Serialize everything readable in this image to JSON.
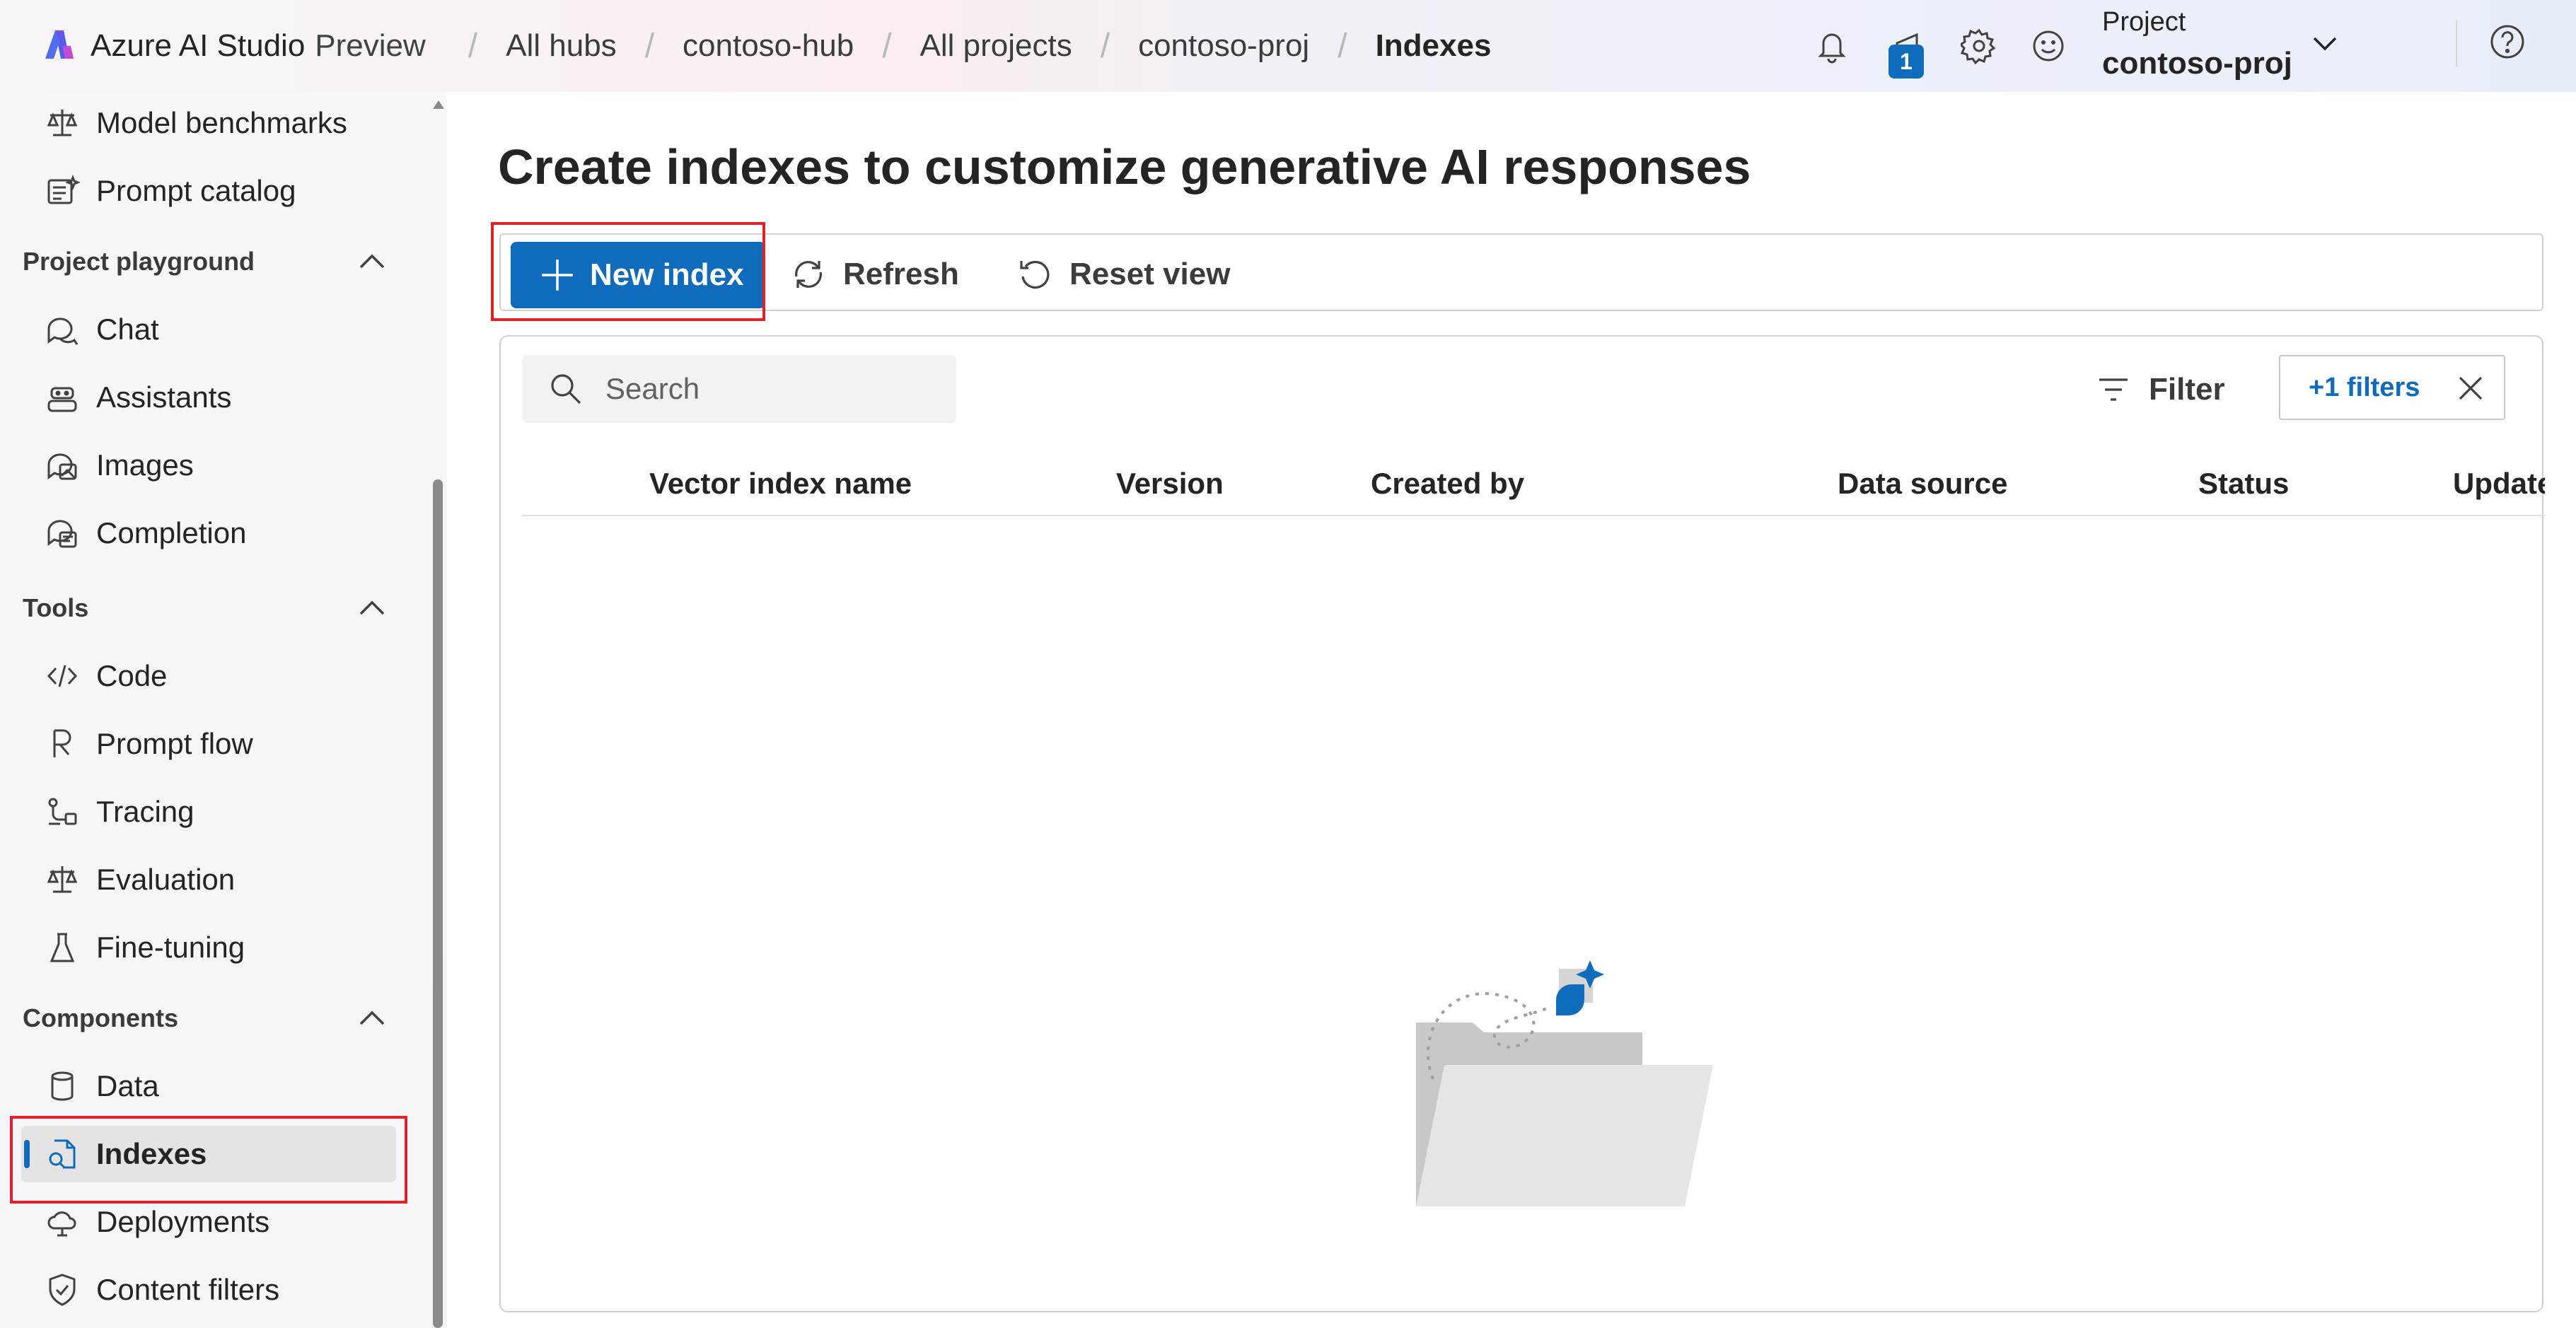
{
  "brand": {
    "name": "Azure AI Studio",
    "suffix": "Preview"
  },
  "breadcrumbs": [
    "All hubs",
    "contoso-hub",
    "All projects",
    "contoso-proj",
    "Indexes"
  ],
  "header": {
    "notification_badge": "1",
    "project_label": "Project",
    "project_name": "contoso-proj"
  },
  "sidebar": {
    "top_items": [
      {
        "label": "Model benchmarks",
        "icon": "scale-icon"
      },
      {
        "label": "Prompt catalog",
        "icon": "catalog-icon"
      }
    ],
    "sections": [
      {
        "title": "Project playground",
        "items": [
          {
            "label": "Chat",
            "icon": "chat-icon"
          },
          {
            "label": "Assistants",
            "icon": "assistant-icon"
          },
          {
            "label": "Images",
            "icon": "images-icon"
          },
          {
            "label": "Completion",
            "icon": "completion-icon"
          }
        ]
      },
      {
        "title": "Tools",
        "items": [
          {
            "label": "Code",
            "icon": "code-icon"
          },
          {
            "label": "Prompt flow",
            "icon": "flow-icon"
          },
          {
            "label": "Tracing",
            "icon": "tracing-icon"
          },
          {
            "label": "Evaluation",
            "icon": "evaluation-icon"
          },
          {
            "label": "Fine-tuning",
            "icon": "flask-icon"
          }
        ]
      },
      {
        "title": "Components",
        "items": [
          {
            "label": "Data",
            "icon": "database-icon"
          },
          {
            "label": "Indexes",
            "icon": "index-icon",
            "active": true
          },
          {
            "label": "Deployments",
            "icon": "cloud-icon"
          },
          {
            "label": "Content filters",
            "icon": "shield-icon"
          }
        ]
      }
    ]
  },
  "main": {
    "title": "Create indexes to customize generative AI responses",
    "toolbar": {
      "new_index": "New index",
      "refresh": "Refresh",
      "reset_view": "Reset view"
    },
    "search_placeholder": "Search",
    "filter_label": "Filter",
    "filter_chip": "+1 filters",
    "columns": [
      "Vector index name",
      "Version",
      "Created by",
      "Data source",
      "Status",
      "Update"
    ]
  },
  "colors": {
    "accent": "#0f6cbd",
    "highlight": "#e0202a"
  }
}
